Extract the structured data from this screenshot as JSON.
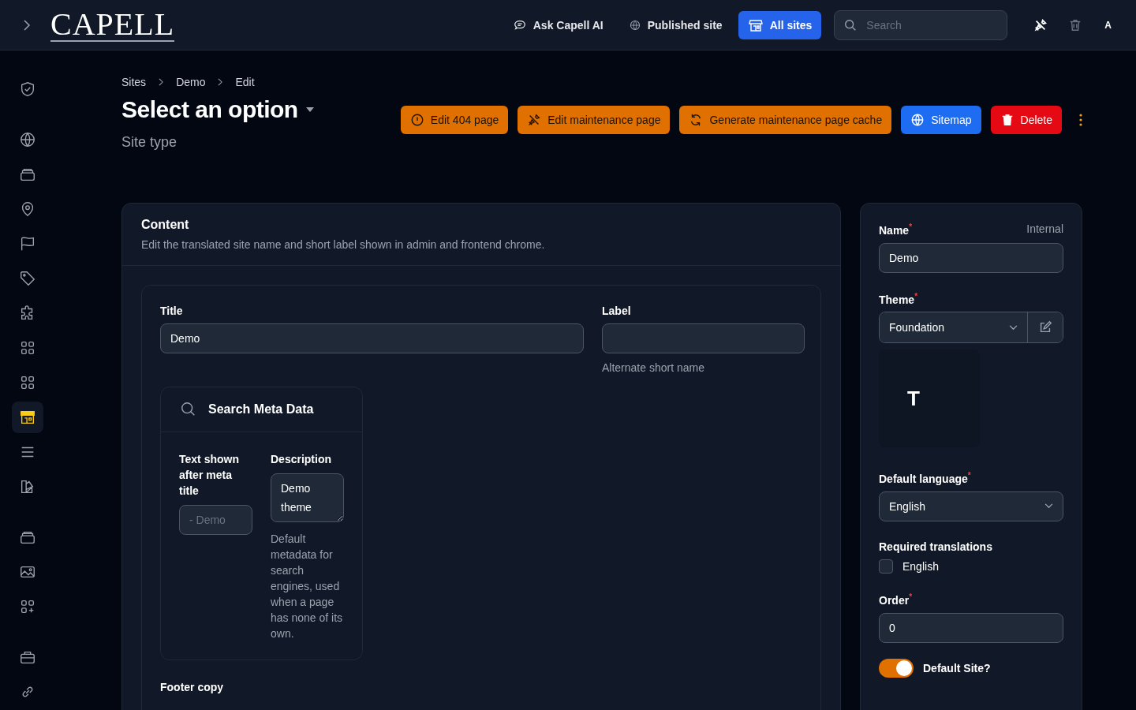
{
  "header": {
    "logo": "CAPELL",
    "nav": [
      {
        "kind": "chat",
        "label": "Ask Capell AI",
        "selected": false
      },
      {
        "kind": "globe",
        "label": "Published site",
        "selected": false
      },
      {
        "kind": "store",
        "label": "All sites",
        "selected": true
      }
    ],
    "search": {
      "placeholder": "Search"
    },
    "avatar": "A"
  },
  "sidebar": {
    "groups": [
      {
        "items": [
          {
            "selected": false
          }
        ]
      },
      {
        "items": [
          {
            "selected": false
          },
          {
            "selected": false
          },
          {
            "selected": false
          },
          {
            "selected": false
          },
          {
            "selected": false
          },
          {
            "selected": false
          },
          {
            "selected": false
          },
          {
            "selected": false
          },
          {
            "selected": true
          },
          {
            "selected": false
          },
          {
            "selected": false
          }
        ]
      },
      {
        "items": [
          {
            "selected": false
          },
          {
            "selected": false
          },
          {
            "selected": false
          }
        ]
      },
      {
        "items": [
          {
            "selected": false
          },
          {
            "selected": false
          }
        ]
      }
    ]
  },
  "breadcrumbs": [
    "Sites",
    "Demo",
    "Edit"
  ],
  "page": {
    "title": "Select an option",
    "subtitle": "Site type"
  },
  "actions": [
    {
      "kind": "warning",
      "label": "Edit 404 page"
    },
    {
      "kind": "warning",
      "label": "Edit maintenance page"
    },
    {
      "kind": "warning",
      "label": "Generate maintenance page cache"
    },
    {
      "kind": "primary",
      "label": "Sitemap"
    },
    {
      "kind": "danger",
      "label": "Delete"
    }
  ],
  "content": {
    "title": "Content",
    "description": "Edit the translated site name and short label shown in admin and frontend chrome.",
    "title_field": {
      "label": "Title",
      "value": "Demo"
    },
    "label_field": {
      "label": "Label",
      "help": "Alternate short name"
    },
    "meta": {
      "title": "Search Meta Data",
      "suffix_label": "Text shown after meta title",
      "suffix_placeholder": "- Demo",
      "description_label": "Description",
      "description_value": "Demo theme",
      "description_help": "Default metadata for search engines, used when a page has none of its own."
    },
    "footer_label": "Footer copy"
  },
  "settings": {
    "name": {
      "label": "Name",
      "required_mark": "*",
      "hint": "Internal",
      "value": "Demo"
    },
    "theme": {
      "label": "Theme",
      "required_mark": "*",
      "value": "Foundation",
      "preview": "T"
    },
    "language": {
      "label": "Default language",
      "required_mark": "*",
      "value": "English"
    },
    "translations": {
      "label": "Required translations",
      "options": [
        {
          "label": "English",
          "checked": false
        }
      ]
    },
    "order": {
      "label": "Order",
      "required_mark": "*",
      "value": "0"
    },
    "default_site": {
      "label": "Default Site?",
      "on": true
    }
  }
}
